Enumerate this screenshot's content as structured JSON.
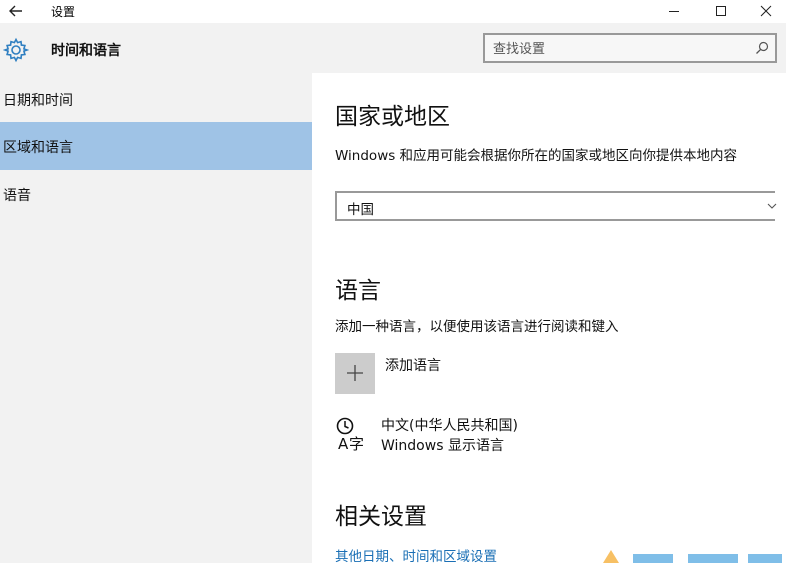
{
  "window": {
    "title": "设置",
    "icons": {
      "back": "back-arrow-icon",
      "minimize": "minimize-icon",
      "maximize": "maximize-icon",
      "close": "close-icon"
    }
  },
  "header": {
    "title": "时间和语言",
    "icon": "gear-icon",
    "search": {
      "placeholder": "查找设置",
      "value": "",
      "icon": "search-icon"
    }
  },
  "sidebar": {
    "items": [
      {
        "label": "日期和时间",
        "selected": false
      },
      {
        "label": "区域和语言",
        "selected": true
      },
      {
        "label": "语音",
        "selected": false
      }
    ],
    "selected_color": "#9fc3e6"
  },
  "main": {
    "country": {
      "heading": "国家或地区",
      "description": "Windows 和应用可能会根据你所在的国家或地区向你提供本地内容",
      "selected": "中国"
    },
    "language": {
      "heading": "语言",
      "description": "添加一种语言，以便使用该语言进行阅读和键入",
      "add_label": "添加语言",
      "installed": [
        {
          "name": "中文(中华人民共和国)",
          "subtitle": "Windows 显示语言",
          "icon": "language-icon"
        }
      ]
    },
    "related": {
      "heading": "相关设置",
      "link": "其他日期、时间和区域设置"
    }
  },
  "colors": {
    "accent": "#1a6fb5",
    "panel": "#f2f2f2"
  }
}
